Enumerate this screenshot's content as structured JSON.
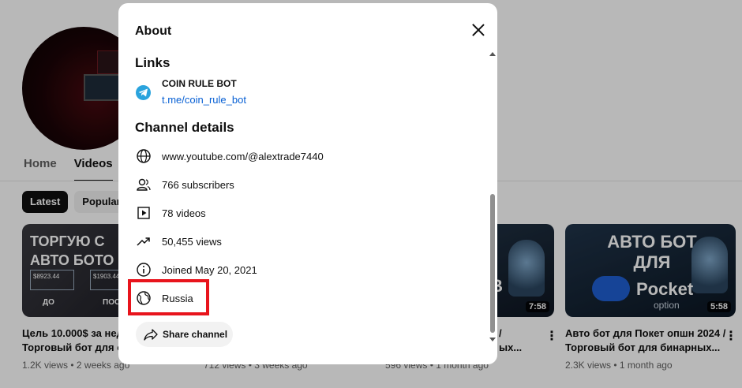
{
  "background": {
    "tabs": [
      {
        "label": "Home",
        "active": false
      },
      {
        "label": "Videos",
        "active": true
      }
    ],
    "chips": [
      {
        "label": "Latest",
        "active": true
      },
      {
        "label": "Popular",
        "active": false
      }
    ],
    "videos": [
      {
        "thumb_text": "ТОРГУЮ С АВТО БОТО",
        "panel_a": "$8923.44",
        "panel_b": "$1903.44",
        "label_a": "ДО",
        "label_b": "ПОС",
        "title_1": "Цель 10.000$ за неде",
        "title_2": "Торговый бот для опц",
        "meta": "1.2K views • 2 weeks ago"
      },
      {
        "title_1": "",
        "title_2": "",
        "meta": "712 views • 3 weeks ago"
      },
      {
        "thumb_text": "ОВ",
        "duration": "7:58",
        "title_1": "/",
        "title_2": "ых...",
        "meta": "596 views • 1 month ago"
      },
      {
        "thumb_text": "АВТО БОТ ДЛЯ",
        "brand": "Pocket",
        "brand_sub": "option",
        "duration": "5:58",
        "title_1": "Авто бот для Покет опшн 2024 /",
        "title_2": "Торговый бот для бинарных...",
        "meta": "2.3K views • 1 month ago"
      }
    ]
  },
  "dialog": {
    "title": "About",
    "links_heading": "Links",
    "link": {
      "name": "COIN RULE BOT",
      "url": "t.me/coin_rule_bot",
      "icon": "telegram-icon"
    },
    "details_heading": "Channel details",
    "details": [
      {
        "icon": "globe-icon",
        "text": "www.youtube.com/@alextrade7440"
      },
      {
        "icon": "subscribers-icon",
        "text": "766 subscribers"
      },
      {
        "icon": "video-icon",
        "text": "78 videos"
      },
      {
        "icon": "trending-icon",
        "text": "50,455 views"
      },
      {
        "icon": "info-icon",
        "text": "Joined May 20, 2021"
      },
      {
        "icon": "location-globe-icon",
        "text": "Russia"
      }
    ],
    "share_label": "Share channel",
    "highlight_color": "#e8141c"
  }
}
